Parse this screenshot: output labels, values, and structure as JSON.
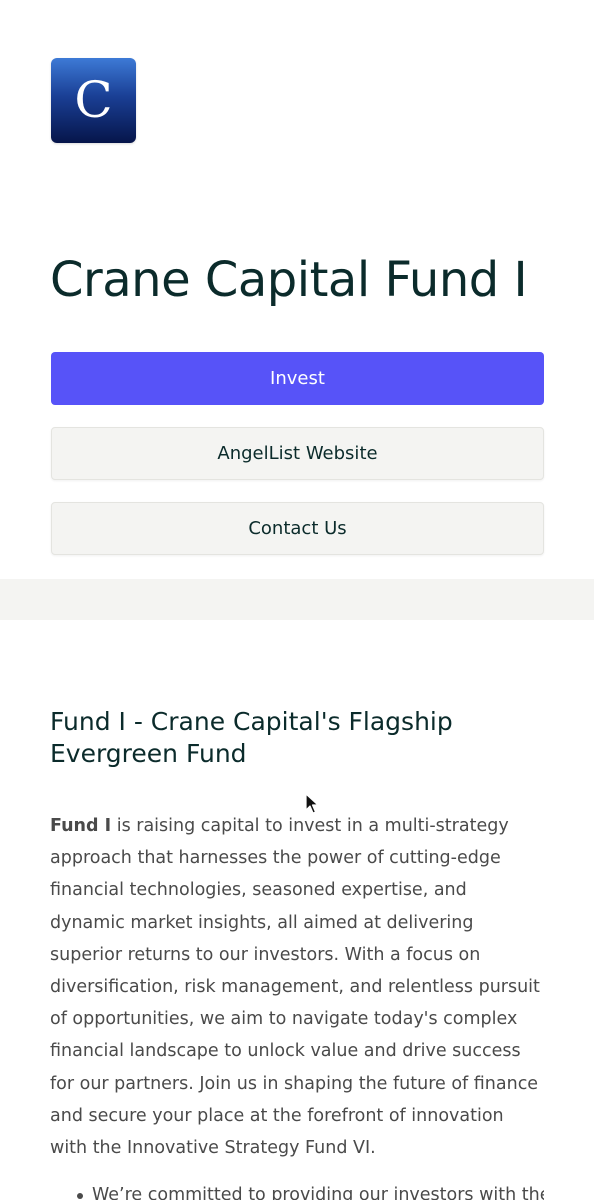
{
  "logo": {
    "letter": "C"
  },
  "fund": {
    "title": "Crane Capital Fund I"
  },
  "buttons": {
    "invest": "Invest",
    "website": "AngelList Website",
    "contact": "Contact Us"
  },
  "section": {
    "title": "Fund I - Crane Capital's Flagship Evergreen Fund",
    "lead_bold": "Fund I",
    "body": " is raising capital to invest in a multi-strategy approach that harnesses the power of cutting-edge financial technologies, seasoned expertise, and dynamic market insights, all aimed at delivering superior returns to our investors. With a focus on diversification, risk management, and relentless pursuit of opportunities, we aim to navigate today's complex financial landscape to unlock value and drive success for our partners. Join us in shaping the future of finance and secure your place at the forefront of innovation with the Innovative Strategy Fund VI.",
    "bullets": [
      "We’re committed to providing our investors with the"
    ]
  },
  "colors": {
    "primary": "#5753f8",
    "heading": "#0b2b2b",
    "body": "#4a4a4a",
    "secondary_bg": "#f4f4f2"
  }
}
